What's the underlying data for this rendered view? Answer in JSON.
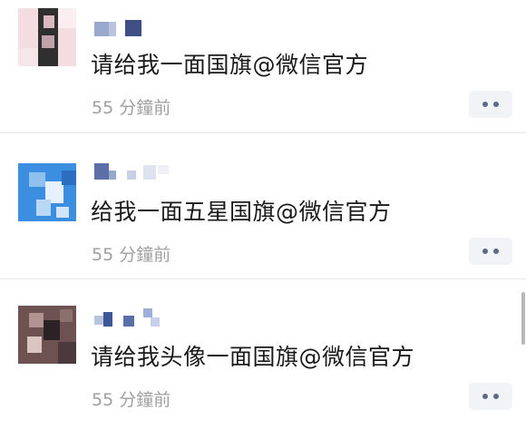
{
  "feed": {
    "posts": [
      {
        "message": "请给我一面国旗@微信官方",
        "timestamp": "55 分鐘前",
        "avatar_colors": [
          "#f6d6dc",
          "#3a3a3a",
          "#e8c9cf",
          "#111111"
        ],
        "username_colors": [
          "#9aa8cc",
          "#3e4f86"
        ]
      },
      {
        "message": "给我一面五星国旗@微信官方",
        "timestamp": "55 分鐘前",
        "avatar_colors": [
          "#3d8fe0",
          "#9cc8f2",
          "#dfeefb",
          "#2c6fc0"
        ],
        "username_colors": [
          "#5c6fa8",
          "#c8cfe2"
        ]
      },
      {
        "message": "请给我头像一面国旗@微信官方",
        "timestamp": "55 分鐘前",
        "avatar_colors": [
          "#6a4e4e",
          "#2a2226",
          "#a88a86",
          "#d8c4c0"
        ],
        "username_colors": [
          "#3e5596",
          "#9fb0d8"
        ]
      }
    ],
    "more_button_icon": "more-dots-icon",
    "accent": "#5b6b86"
  }
}
